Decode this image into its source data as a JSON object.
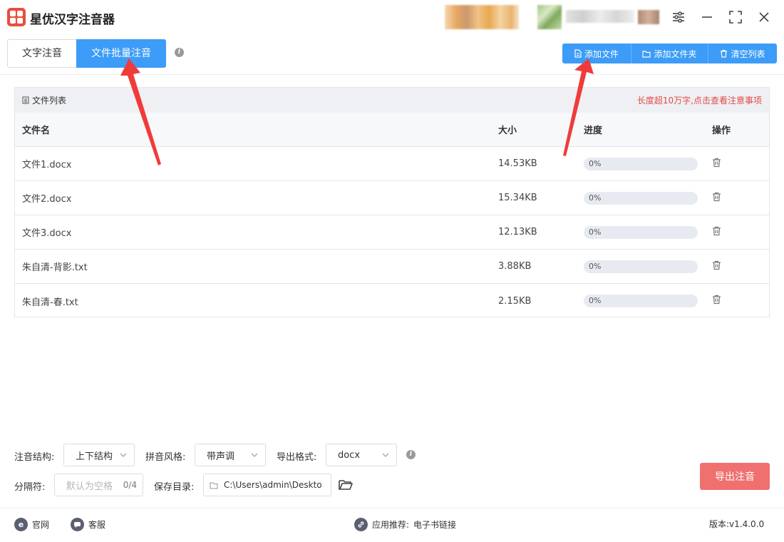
{
  "app": {
    "title": "星优汉字注音器"
  },
  "tabs": [
    {
      "label": "文字注音",
      "active": false
    },
    {
      "label": "文件批量注音",
      "active": true
    }
  ],
  "toolbar": {
    "add_file": "添加文件",
    "add_folder": "添加文件夹",
    "clear_list": "清空列表"
  },
  "file_list": {
    "title": "文件列表",
    "notice": "长度超10万字,点击查看注意事项",
    "columns": {
      "name": "文件名",
      "size": "大小",
      "progress": "进度",
      "action": "操作"
    },
    "rows": [
      {
        "name": "文件1.docx",
        "size": "14.53KB",
        "progress": "0%",
        "progress_value": 0
      },
      {
        "name": "文件2.docx",
        "size": "15.34KB",
        "progress": "0%",
        "progress_value": 0
      },
      {
        "name": "文件3.docx",
        "size": "12.13KB",
        "progress": "0%",
        "progress_value": 0
      },
      {
        "name": "朱自清-背影.txt",
        "size": "3.88KB",
        "progress": "0%",
        "progress_value": 0
      },
      {
        "name": "朱自清-春.txt",
        "size": "2.15KB",
        "progress": "0%",
        "progress_value": 0
      }
    ]
  },
  "settings": {
    "structure_label": "注音结构:",
    "structure_value": "上下结构",
    "style_label": "拼音风格:",
    "style_value": "带声调",
    "format_label": "导出格式:",
    "format_value": "docx",
    "separator_label": "分隔符:",
    "separator_placeholder": "默认为空格",
    "separator_count": "0/4",
    "save_label": "保存目录:",
    "save_value": "C:\\Users\\admin\\Deskto"
  },
  "export_button": "导出注音",
  "footer": {
    "website": "官网",
    "support": "客服",
    "recommend_label": "应用推荐:",
    "recommend_link": "电子书链接",
    "version": "版本:v1.4.0.0"
  },
  "colors": {
    "primary": "#3c9cf7",
    "export": "#f07070",
    "notice": "#e34a4a",
    "annotation_arrow": "#f03b3b"
  }
}
